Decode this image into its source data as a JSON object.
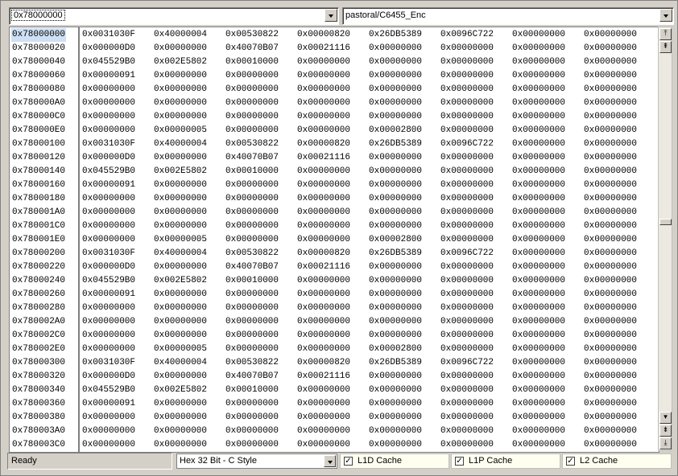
{
  "address_input": {
    "value": "0x78000000"
  },
  "context_select": {
    "value": "pastoral/C6455_Enc"
  },
  "memory": {
    "selected_address": "0x78000000",
    "rows": [
      {
        "addr": "0x78000000",
        "cells": [
          "0x0031030F",
          "0x40000004",
          "0x00530822",
          "0x00000820",
          "0x26DB5389",
          "0x0096C722",
          "0x00000000",
          "0x00000000"
        ]
      },
      {
        "addr": "0x78000020",
        "cells": [
          "0x000000D0",
          "0x00000000",
          "0x40070B07",
          "0x00021116",
          "0x00000000",
          "0x00000000",
          "0x00000000",
          "0x00000000"
        ]
      },
      {
        "addr": "0x78000040",
        "cells": [
          "0x045529B0",
          "0x002E5802",
          "0x00010000",
          "0x00000000",
          "0x00000000",
          "0x00000000",
          "0x00000000",
          "0x00000000"
        ]
      },
      {
        "addr": "0x78000060",
        "cells": [
          "0x00000091",
          "0x00000000",
          "0x00000000",
          "0x00000000",
          "0x00000000",
          "0x00000000",
          "0x00000000",
          "0x00000000"
        ]
      },
      {
        "addr": "0x78000080",
        "cells": [
          "0x00000000",
          "0x00000000",
          "0x00000000",
          "0x00000000",
          "0x00000000",
          "0x00000000",
          "0x00000000",
          "0x00000000"
        ]
      },
      {
        "addr": "0x780000A0",
        "cells": [
          "0x00000000",
          "0x00000000",
          "0x00000000",
          "0x00000000",
          "0x00000000",
          "0x00000000",
          "0x00000000",
          "0x00000000"
        ]
      },
      {
        "addr": "0x780000C0",
        "cells": [
          "0x00000000",
          "0x00000000",
          "0x00000000",
          "0x00000000",
          "0x00000000",
          "0x00000000",
          "0x00000000",
          "0x00000000"
        ]
      },
      {
        "addr": "0x780000E0",
        "cells": [
          "0x00000000",
          "0x00000005",
          "0x00000000",
          "0x00000000",
          "0x00002800",
          "0x00000000",
          "0x00000000",
          "0x00000000"
        ]
      },
      {
        "addr": "0x78000100",
        "cells": [
          "0x0031030F",
          "0x40000004",
          "0x00530822",
          "0x00000820",
          "0x26DB5389",
          "0x0096C722",
          "0x00000000",
          "0x00000000"
        ]
      },
      {
        "addr": "0x78000120",
        "cells": [
          "0x000000D0",
          "0x00000000",
          "0x40070B07",
          "0x00021116",
          "0x00000000",
          "0x00000000",
          "0x00000000",
          "0x00000000"
        ]
      },
      {
        "addr": "0x78000140",
        "cells": [
          "0x045529B0",
          "0x002E5802",
          "0x00010000",
          "0x00000000",
          "0x00000000",
          "0x00000000",
          "0x00000000",
          "0x00000000"
        ]
      },
      {
        "addr": "0x78000160",
        "cells": [
          "0x00000091",
          "0x00000000",
          "0x00000000",
          "0x00000000",
          "0x00000000",
          "0x00000000",
          "0x00000000",
          "0x00000000"
        ]
      },
      {
        "addr": "0x78000180",
        "cells": [
          "0x00000000",
          "0x00000000",
          "0x00000000",
          "0x00000000",
          "0x00000000",
          "0x00000000",
          "0x00000000",
          "0x00000000"
        ]
      },
      {
        "addr": "0x780001A0",
        "cells": [
          "0x00000000",
          "0x00000000",
          "0x00000000",
          "0x00000000",
          "0x00000000",
          "0x00000000",
          "0x00000000",
          "0x00000000"
        ]
      },
      {
        "addr": "0x780001C0",
        "cells": [
          "0x00000000",
          "0x00000000",
          "0x00000000",
          "0x00000000",
          "0x00000000",
          "0x00000000",
          "0x00000000",
          "0x00000000"
        ]
      },
      {
        "addr": "0x780001E0",
        "cells": [
          "0x00000000",
          "0x00000005",
          "0x00000000",
          "0x00000000",
          "0x00002800",
          "0x00000000",
          "0x00000000",
          "0x00000000"
        ]
      },
      {
        "addr": "0x78000200",
        "cells": [
          "0x0031030F",
          "0x40000004",
          "0x00530822",
          "0x00000820",
          "0x26DB5389",
          "0x0096C722",
          "0x00000000",
          "0x00000000"
        ]
      },
      {
        "addr": "0x78000220",
        "cells": [
          "0x000000D0",
          "0x00000000",
          "0x40070B07",
          "0x00021116",
          "0x00000000",
          "0x00000000",
          "0x00000000",
          "0x00000000"
        ]
      },
      {
        "addr": "0x78000240",
        "cells": [
          "0x045529B0",
          "0x002E5802",
          "0x00010000",
          "0x00000000",
          "0x00000000",
          "0x00000000",
          "0x00000000",
          "0x00000000"
        ]
      },
      {
        "addr": "0x78000260",
        "cells": [
          "0x00000091",
          "0x00000000",
          "0x00000000",
          "0x00000000",
          "0x00000000",
          "0x00000000",
          "0x00000000",
          "0x00000000"
        ]
      },
      {
        "addr": "0x78000280",
        "cells": [
          "0x00000000",
          "0x00000000",
          "0x00000000",
          "0x00000000",
          "0x00000000",
          "0x00000000",
          "0x00000000",
          "0x00000000"
        ]
      },
      {
        "addr": "0x780002A0",
        "cells": [
          "0x00000000",
          "0x00000000",
          "0x00000000",
          "0x00000000",
          "0x00000000",
          "0x00000000",
          "0x00000000",
          "0x00000000"
        ]
      },
      {
        "addr": "0x780002C0",
        "cells": [
          "0x00000000",
          "0x00000000",
          "0x00000000",
          "0x00000000",
          "0x00000000",
          "0x00000000",
          "0x00000000",
          "0x00000000"
        ]
      },
      {
        "addr": "0x780002E0",
        "cells": [
          "0x00000000",
          "0x00000005",
          "0x00000000",
          "0x00000000",
          "0x00002800",
          "0x00000000",
          "0x00000000",
          "0x00000000"
        ]
      },
      {
        "addr": "0x78000300",
        "cells": [
          "0x0031030F",
          "0x40000004",
          "0x00530822",
          "0x00000820",
          "0x26DB5389",
          "0x0096C722",
          "0x00000000",
          "0x00000000"
        ]
      },
      {
        "addr": "0x78000320",
        "cells": [
          "0x000000D0",
          "0x00000000",
          "0x40070B07",
          "0x00021116",
          "0x00000000",
          "0x00000000",
          "0x00000000",
          "0x00000000"
        ]
      },
      {
        "addr": "0x78000340",
        "cells": [
          "0x045529B0",
          "0x002E5802",
          "0x00010000",
          "0x00000000",
          "0x00000000",
          "0x00000000",
          "0x00000000",
          "0x00000000"
        ]
      },
      {
        "addr": "0x78000360",
        "cells": [
          "0x00000091",
          "0x00000000",
          "0x00000000",
          "0x00000000",
          "0x00000000",
          "0x00000000",
          "0x00000000",
          "0x00000000"
        ]
      },
      {
        "addr": "0x78000380",
        "cells": [
          "0x00000000",
          "0x00000000",
          "0x00000000",
          "0x00000000",
          "0x00000000",
          "0x00000000",
          "0x00000000",
          "0x00000000"
        ]
      },
      {
        "addr": "0x780003A0",
        "cells": [
          "0x00000000",
          "0x00000000",
          "0x00000000",
          "0x00000000",
          "0x00000000",
          "0x00000000",
          "0x00000000",
          "0x00000000"
        ]
      },
      {
        "addr": "0x780003C0",
        "cells": [
          "0x00000000",
          "0x00000000",
          "0x00000000",
          "0x00000000",
          "0x00000000",
          "0x00000000",
          "0x00000000",
          "0x00000000"
        ]
      }
    ]
  },
  "scrollbar": {
    "top_buttons": [
      "page-top-icon",
      "page-up-icon"
    ],
    "bottom_buttons": [
      "scroll-down-icon",
      "page-down-icon",
      "page-bottom-icon"
    ],
    "position_fraction": 0.47
  },
  "status_bar": {
    "status": "Ready",
    "format_select": "Hex 32 Bit - C Style",
    "caches": [
      {
        "label": "L1D Cache",
        "checked": true
      },
      {
        "label": "L1P Cache",
        "checked": true
      },
      {
        "label": "L2 Cache",
        "checked": true
      }
    ]
  },
  "colors": {
    "selection": "#cfe0f5",
    "chrome": "#d4d0c8",
    "cache_bg": "#fffff0"
  }
}
